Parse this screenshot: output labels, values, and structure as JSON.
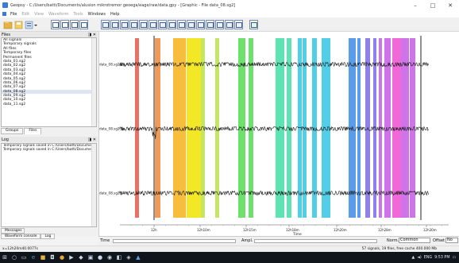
{
  "window": {
    "title": "Geopsy - C:/Users/batti/Documents/alusion mikrotremor geoega/eage/raw/data.gpy - [Graphic - File data_08.sg2]",
    "minimize": "–",
    "maximize": "□",
    "close": "✕"
  },
  "menu": {
    "items": [
      {
        "label": "File",
        "disabled": false
      },
      {
        "label": "Edit",
        "disabled": true
      },
      {
        "label": "View",
        "disabled": true
      },
      {
        "label": "Waveform",
        "disabled": true
      },
      {
        "label": "Tools",
        "disabled": true
      },
      {
        "label": "Windows",
        "disabled": false
      },
      {
        "label": "Help",
        "disabled": false
      }
    ]
  },
  "files_panel": {
    "header": "Files",
    "header_buttons": "◨ ✕",
    "items": [
      "All signals",
      "Temporary signals",
      "All files",
      "Temporary files",
      "Permanent files",
      "data_01.sg2",
      "data_02.sg2",
      "data_03.sg2",
      "data_04.sg2",
      "data_05.sg2",
      "data_06.sg2",
      "data_07.sg2",
      "data_08.sg2",
      "data_09.sg2",
      "data_10.sg2",
      "data_11.sg2"
    ],
    "selected_index": 12,
    "tabs": [
      "Groups",
      "Files"
    ],
    "active_tab": 1
  },
  "log_panel": {
    "header": "Log",
    "header_buttons": "◨ ✕",
    "lines": [
      "Temporary signals saved in C:/Users/batti/Documen",
      "Temporary signals saved in C:/Users/batti/Documen"
    ],
    "tabs": [
      "Messages",
      "Waveform console",
      "Log"
    ]
  },
  "graph": {
    "traces": [
      {
        "label": "data_08.sg2:2-"
      },
      {
        "label": "data_08.sg2:3-"
      },
      {
        "label": "data_08.sg2:1-"
      }
    ],
    "x_ticks": [
      "12h",
      "12h10m",
      "12h15m",
      "12h18m",
      "12h20m",
      "12h28m",
      "12h30m"
    ],
    "x_axis_label": "Time",
    "window_colors": [
      "#e8574a",
      "#ef8a3c",
      "#f6b21b",
      "#f2e300",
      "#b8e24a",
      "#52dc52",
      "#3fe0a6",
      "#35c6e3",
      "#3c8be6",
      "#7d6ae6",
      "#c55ae6",
      "#ec4fd2"
    ]
  },
  "bottombar": {
    "time_label": "Time",
    "ampl_label": "Ampl.",
    "norm_label": "Norm.",
    "norm_value": "Common",
    "offset_label": "Offset",
    "offset_value": "No"
  },
  "statusbar": {
    "left": "x=12h20m40.0077s",
    "right": "57 signals, 19 files, free cache 400.000 Mb"
  },
  "taskbar": {
    "time": "9:53 PM",
    "lang": "ENG"
  }
}
